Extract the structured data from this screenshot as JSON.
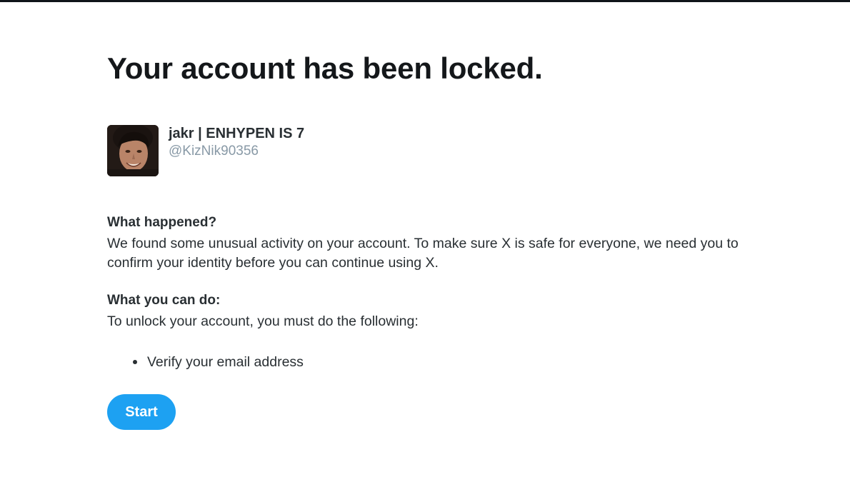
{
  "page": {
    "title": "Your account has been locked."
  },
  "user": {
    "display_name": "jakr | ENHYPEN IS 7",
    "handle": "@KizNik90356",
    "avatar_icon": "user-avatar-photo"
  },
  "what_happened": {
    "heading": "What happened?",
    "body": "We found some unusual activity on your account. To make sure X is safe for everyone, we need you to confirm your identity before you can continue using X."
  },
  "what_you_can_do": {
    "heading": "What you can do:",
    "body": "To unlock your account, you must do the following:",
    "steps": [
      {
        "label": "Verify your email address"
      }
    ]
  },
  "actions": {
    "start_label": "Start"
  },
  "colors": {
    "accent": "#1da1f2",
    "text_primary": "#14171a",
    "text_secondary": "#8899a6",
    "top_rule": "#0f1419"
  }
}
